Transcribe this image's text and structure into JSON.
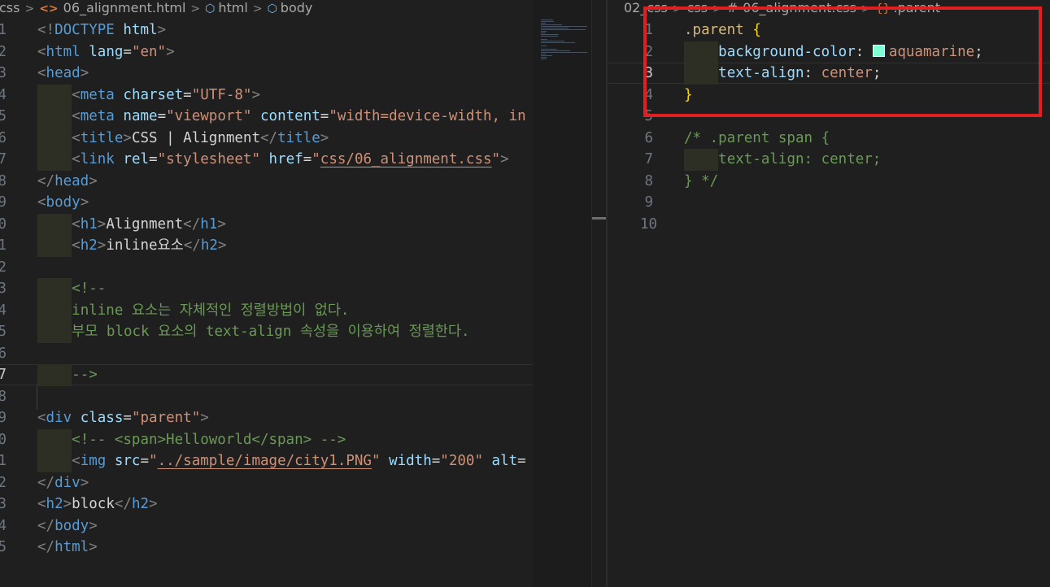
{
  "left_editor": {
    "breadcrumb": [
      "css",
      "06_alignment.html",
      "html",
      "body"
    ],
    "lines": [
      {
        "num": "1",
        "segs": [
          [
            "punct",
            "<!"
          ],
          [
            "tag",
            "DOCTYPE"
          ],
          [
            "plain",
            " "
          ],
          [
            "attr",
            "html"
          ],
          [
            "punct",
            ">"
          ]
        ]
      },
      {
        "num": "2",
        "segs": [
          [
            "punct",
            "<"
          ],
          [
            "tag",
            "html"
          ],
          [
            "plain",
            " "
          ],
          [
            "attr",
            "lang"
          ],
          [
            "plain",
            "="
          ],
          [
            "str",
            "\"en\""
          ],
          [
            "punct",
            ">"
          ]
        ]
      },
      {
        "num": "3",
        "segs": [
          [
            "punct",
            "<"
          ],
          [
            "tag",
            "head"
          ],
          [
            "punct",
            ">"
          ]
        ]
      },
      {
        "num": "4",
        "segs": [
          [
            "indent",
            "    "
          ],
          [
            "punct",
            "<"
          ],
          [
            "tag",
            "meta"
          ],
          [
            "plain",
            " "
          ],
          [
            "attr",
            "charset"
          ],
          [
            "plain",
            "="
          ],
          [
            "str",
            "\"UTF-8\""
          ],
          [
            "punct",
            ">"
          ]
        ]
      },
      {
        "num": "5",
        "segs": [
          [
            "indent",
            "    "
          ],
          [
            "punct",
            "<"
          ],
          [
            "tag",
            "meta"
          ],
          [
            "plain",
            " "
          ],
          [
            "attr",
            "name"
          ],
          [
            "plain",
            "="
          ],
          [
            "str",
            "\"viewport\""
          ],
          [
            "plain",
            " "
          ],
          [
            "attr",
            "content"
          ],
          [
            "plain",
            "="
          ],
          [
            "str",
            "\"width=device-width, in"
          ]
        ]
      },
      {
        "num": "6",
        "segs": [
          [
            "indent",
            "    "
          ],
          [
            "punct",
            "<"
          ],
          [
            "tag",
            "title"
          ],
          [
            "punct",
            ">"
          ],
          [
            "plain",
            "CSS | Alignment"
          ],
          [
            "punct",
            "</"
          ],
          [
            "tag",
            "title"
          ],
          [
            "punct",
            ">"
          ]
        ]
      },
      {
        "num": "7",
        "segs": [
          [
            "indent",
            "    "
          ],
          [
            "punct",
            "<"
          ],
          [
            "tag",
            "link"
          ],
          [
            "plain",
            " "
          ],
          [
            "attr",
            "rel"
          ],
          [
            "plain",
            "="
          ],
          [
            "str",
            "\"stylesheet\""
          ],
          [
            "plain",
            " "
          ],
          [
            "attr",
            "href"
          ],
          [
            "plain",
            "="
          ],
          [
            "str",
            "\""
          ],
          [
            "link",
            "css/06_alignment.css"
          ],
          [
            "str",
            "\""
          ],
          [
            "punct",
            ">"
          ]
        ]
      },
      {
        "num": "8",
        "segs": [
          [
            "punct",
            "</"
          ],
          [
            "tag",
            "head"
          ],
          [
            "punct",
            ">"
          ]
        ]
      },
      {
        "num": "9",
        "segs": [
          [
            "punct",
            "<"
          ],
          [
            "tag",
            "body"
          ],
          [
            "punct",
            ">"
          ]
        ]
      },
      {
        "num": "0",
        "segs": [
          [
            "indent",
            "    "
          ],
          [
            "punct",
            "<"
          ],
          [
            "tag",
            "h1"
          ],
          [
            "punct",
            ">"
          ],
          [
            "plain",
            "Alignment"
          ],
          [
            "punct",
            "</"
          ],
          [
            "tag",
            "h1"
          ],
          [
            "punct",
            ">"
          ]
        ]
      },
      {
        "num": "1",
        "segs": [
          [
            "indent",
            "    "
          ],
          [
            "punct",
            "<"
          ],
          [
            "tag",
            "h2"
          ],
          [
            "punct",
            ">"
          ],
          [
            "plain",
            "inline요소"
          ],
          [
            "punct",
            "</"
          ],
          [
            "tag",
            "h2"
          ],
          [
            "punct",
            ">"
          ]
        ]
      },
      {
        "num": "2",
        "segs": []
      },
      {
        "num": "3",
        "segs": [
          [
            "indent",
            "    "
          ],
          [
            "com",
            "<!--"
          ]
        ]
      },
      {
        "num": "4",
        "segs": [
          [
            "indent",
            "    "
          ],
          [
            "com",
            "inline 요소는 자체적인 정렬방법이 없다."
          ]
        ]
      },
      {
        "num": "5",
        "segs": [
          [
            "indent",
            "    "
          ],
          [
            "com",
            "부모 block 요소의 text-align 속성을 이용하여 정렬한다."
          ]
        ]
      },
      {
        "num": "6",
        "segs": []
      },
      {
        "num": "7",
        "active": true,
        "segs": [
          [
            "indent",
            "    "
          ],
          [
            "com",
            "-->"
          ]
        ]
      },
      {
        "num": "8",
        "segs": []
      },
      {
        "num": "9",
        "segs": [
          [
            "punct",
            "<"
          ],
          [
            "tag",
            "div"
          ],
          [
            "plain",
            " "
          ],
          [
            "attr",
            "class"
          ],
          [
            "plain",
            "="
          ],
          [
            "str",
            "\"parent\""
          ],
          [
            "punct",
            ">"
          ]
        ]
      },
      {
        "num": "0",
        "segs": [
          [
            "indent",
            "    "
          ],
          [
            "com",
            "<!-- <span>Helloworld</span> -->"
          ]
        ]
      },
      {
        "num": "1",
        "segs": [
          [
            "indent",
            "    "
          ],
          [
            "punct",
            "<"
          ],
          [
            "tag",
            "img"
          ],
          [
            "plain",
            " "
          ],
          [
            "attr",
            "src"
          ],
          [
            "plain",
            "="
          ],
          [
            "str",
            "\""
          ],
          [
            "link",
            "../sample/image/city1.PNG"
          ],
          [
            "str",
            "\""
          ],
          [
            "plain",
            " "
          ],
          [
            "attr",
            "width"
          ],
          [
            "plain",
            "="
          ],
          [
            "str",
            "\"200\""
          ],
          [
            "plain",
            " "
          ],
          [
            "attr",
            "alt"
          ],
          [
            "plain",
            "="
          ]
        ]
      },
      {
        "num": "2",
        "segs": [
          [
            "punct",
            "</"
          ],
          [
            "tag",
            "div"
          ],
          [
            "punct",
            ">"
          ]
        ]
      },
      {
        "num": "3",
        "segs": [
          [
            "punct",
            "<"
          ],
          [
            "tag",
            "h2"
          ],
          [
            "punct",
            ">"
          ],
          [
            "plain",
            "block"
          ],
          [
            "punct",
            "</"
          ],
          [
            "tag",
            "h2"
          ],
          [
            "punct",
            ">"
          ]
        ]
      },
      {
        "num": "4",
        "segs": [
          [
            "punct",
            "</"
          ],
          [
            "tag",
            "body"
          ],
          [
            "punct",
            ">"
          ]
        ]
      },
      {
        "num": "5",
        "segs": [
          [
            "punct",
            "</"
          ],
          [
            "tag",
            "html"
          ],
          [
            "punct",
            ">"
          ]
        ]
      }
    ]
  },
  "right_editor": {
    "breadcrumb": [
      "02_css",
      "css",
      "06_alignment.css",
      ".parent"
    ],
    "lines": [
      {
        "num": "1",
        "segs": [
          [
            "sel",
            ".parent"
          ],
          [
            "plain",
            " "
          ],
          [
            "brace",
            "{"
          ]
        ]
      },
      {
        "num": "2",
        "segs": [
          [
            "indent",
            "    "
          ],
          [
            "prop",
            "background-color"
          ],
          [
            "plain",
            ": "
          ],
          [
            "swatch",
            "#7fffd4"
          ],
          [
            "val",
            "aquamarine"
          ],
          [
            "plain",
            ";"
          ]
        ]
      },
      {
        "num": "3",
        "active": true,
        "segs": [
          [
            "indent",
            "    "
          ],
          [
            "prop",
            "text-align"
          ],
          [
            "plain",
            ": "
          ],
          [
            "val",
            "center"
          ],
          [
            "plain",
            ";"
          ]
        ]
      },
      {
        "num": "4",
        "segs": [
          [
            "brace",
            "}"
          ]
        ]
      },
      {
        "num": "5",
        "segs": []
      },
      {
        "num": "6",
        "segs": [
          [
            "com",
            "/* .parent span {"
          ]
        ]
      },
      {
        "num": "7",
        "segs": [
          [
            "indent",
            "    "
          ],
          [
            "com",
            "text-align: center;"
          ]
        ]
      },
      {
        "num": "8",
        "segs": [
          [
            "com",
            "} */"
          ]
        ]
      },
      {
        "num": "9",
        "segs": []
      },
      {
        "num": "10",
        "segs": []
      }
    ]
  },
  "colors": {
    "highlight_box": "#e02020",
    "swatch": "#7fffd4"
  }
}
